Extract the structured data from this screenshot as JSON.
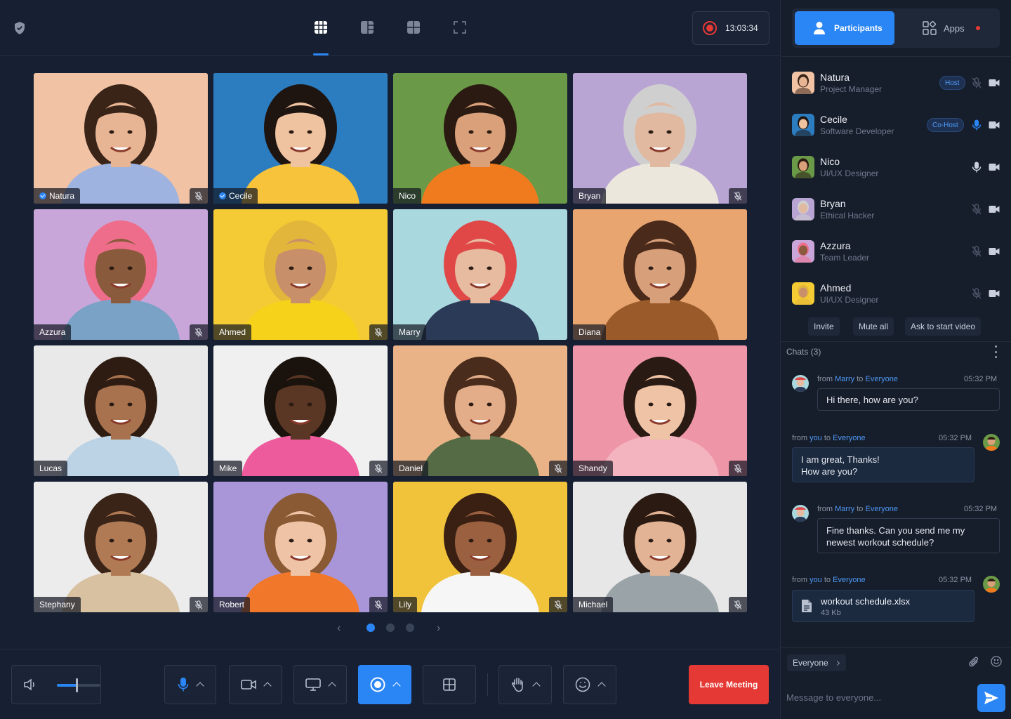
{
  "recording": {
    "time": "13:03:34"
  },
  "view_modes": [
    "grid-view",
    "sidebar-view",
    "quad-view",
    "fullscreen-view"
  ],
  "grid": {
    "tiles": [
      {
        "name": "Natura",
        "verified": true,
        "muted": true,
        "bg": "#f1c2a4",
        "shirt": "#9fb3e0",
        "skin": "#e8b594",
        "hair": "#3a2418"
      },
      {
        "name": "Cecile",
        "verified": true,
        "muted": false,
        "active": true,
        "bg": "#2b7dc0",
        "shirt": "#f6c33a",
        "skin": "#f0c3a0",
        "hair": "#1e1410"
      },
      {
        "name": "Nico",
        "verified": false,
        "muted": false,
        "bg": "#6a9a47",
        "shirt": "#f07a1e",
        "skin": "#d9a07a",
        "hair": "#2a1a12"
      },
      {
        "name": "Bryan",
        "verified": false,
        "muted": true,
        "bg": "#b9a5d4",
        "shirt": "#ece7dd",
        "skin": "#e0b9a0",
        "hair": "#cfcfcf"
      },
      {
        "name": "Azzura",
        "verified": false,
        "muted": true,
        "bg": "#c9a6d9",
        "shirt": "#7aa2c6",
        "skin": "#8a5a3c",
        "hair": "#ee6d8a"
      },
      {
        "name": "Ahmed",
        "verified": false,
        "muted": true,
        "bg": "#f4cb34",
        "shirt": "#f6d21b",
        "skin": "#c8906a",
        "hair": "#e2b53b"
      },
      {
        "name": "Marry",
        "verified": false,
        "muted": false,
        "bg": "#a9d9df",
        "shirt": "#2b3a56",
        "skin": "#e7bba0",
        "hair": "#e04848"
      },
      {
        "name": "Diana",
        "verified": false,
        "muted": false,
        "bg": "#e9a56f",
        "shirt": "#9a5a2a",
        "skin": "#d79f7a",
        "hair": "#4a2a1a"
      },
      {
        "name": "Lucas",
        "verified": false,
        "muted": false,
        "bg": "#e9e9e9",
        "shirt": "#bcd3e6",
        "skin": "#a8724e",
        "hair": "#2e1c12"
      },
      {
        "name": "Mike",
        "verified": false,
        "muted": true,
        "bg": "#f0f0f0",
        "shirt": "#ee5b9d",
        "skin": "#5a3624",
        "hair": "#1a120c"
      },
      {
        "name": "Daniel",
        "verified": false,
        "muted": true,
        "bg": "#e9b387",
        "shirt": "#556b45",
        "skin": "#e2ad88",
        "hair": "#4a2c1c"
      },
      {
        "name": "Shandy",
        "verified": false,
        "muted": true,
        "bg": "#ee95a8",
        "shirt": "#f4b4bf",
        "skin": "#efc3a5",
        "hair": "#2a1a14"
      },
      {
        "name": "Stephany",
        "verified": false,
        "muted": true,
        "bg": "#ececec",
        "shirt": "#d7c1a0",
        "skin": "#b07a54",
        "hair": "#3a2418"
      },
      {
        "name": "Robert",
        "verified": false,
        "muted": true,
        "bg": "#a996d8",
        "shirt": "#f1782a",
        "skin": "#efc4a6",
        "hair": "#8a5a34"
      },
      {
        "name": "Lily",
        "verified": false,
        "muted": true,
        "bg": "#f0c33a",
        "shirt": "#f6f6f6",
        "skin": "#9a6040",
        "hair": "#3a2012"
      },
      {
        "name": "Michael",
        "verified": false,
        "muted": true,
        "bg": "#e7e7e7",
        "shirt": "#9aa3a8",
        "skin": "#e2b394",
        "hair": "#2a1a12"
      }
    ]
  },
  "pager": {
    "current": 1,
    "total": 3
  },
  "controls": {
    "leave_label": "Leave Meeting",
    "volume_level": 0.45
  },
  "side": {
    "tabs": {
      "participants": "Participants",
      "apps": "Apps"
    },
    "participants": [
      {
        "name": "Natura",
        "role": "Project Manager",
        "badge": "Host",
        "mic_on": false,
        "avatar_bg": "#f1c2a4",
        "avatar_skin": "#e8b594",
        "avatar_hair": "#3a2418"
      },
      {
        "name": "Cecile",
        "role": "Software Developer",
        "badge": "Co-Host",
        "mic_on": true,
        "avatar_bg": "#2b7dc0",
        "avatar_skin": "#f0c3a0",
        "avatar_hair": "#1e1410"
      },
      {
        "name": "Nico",
        "role": "UI/UX Designer",
        "badge": "",
        "mic_on": true,
        "avatar_bg": "#6a9a47",
        "avatar_skin": "#d9a07a",
        "avatar_hair": "#2a1a12"
      },
      {
        "name": "Bryan",
        "role": "Ethical Hacker",
        "badge": "",
        "mic_on": false,
        "avatar_bg": "#b9a5d4",
        "avatar_skin": "#e0b9a0",
        "avatar_hair": "#cfcfcf"
      },
      {
        "name": "Azzura",
        "role": "Team Leader",
        "badge": "",
        "mic_on": false,
        "avatar_bg": "#c9a6d9",
        "avatar_skin": "#8a5a3c",
        "avatar_hair": "#ee6d8a"
      },
      {
        "name": "Ahmed",
        "role": "UI/UX Designer",
        "badge": "",
        "mic_on": false,
        "avatar_bg": "#f4cb34",
        "avatar_skin": "#c8906a",
        "avatar_hair": "#e2b53b"
      }
    ],
    "actions": {
      "invite": "Invite",
      "mute_all": "Mute all",
      "ask_video": "Ask to start video"
    },
    "chats_label": "Chats (3)",
    "messages": [
      {
        "from": "Marry",
        "to": "Everyone",
        "time": "05:32 PM",
        "text": "Hi there, how are you?",
        "mine": false
      },
      {
        "from": "you",
        "to": "Everyone",
        "time": "05:32 PM",
        "text_lines": [
          "I am great, Thanks!",
          "How are you?"
        ],
        "mine": true
      },
      {
        "from": "Marry",
        "to": "Everyone",
        "time": "05:32 PM",
        "text_lines": [
          "Fine thanks. Can you send me my",
          "newest workout schedule?"
        ],
        "mine": false
      },
      {
        "from": "you",
        "to": "Everyone",
        "time": "05:32 PM",
        "file": "workout schedule.xlsx",
        "size": "43 Kb",
        "mine": true
      }
    ],
    "labels": {
      "from": "from",
      "to": "to"
    },
    "recipient": "Everyone",
    "input_placeholder": "Message to everyone..."
  },
  "colors": {
    "accent": "#2b86f5",
    "danger": "#e53935",
    "active_tile": "#f2d33f"
  }
}
